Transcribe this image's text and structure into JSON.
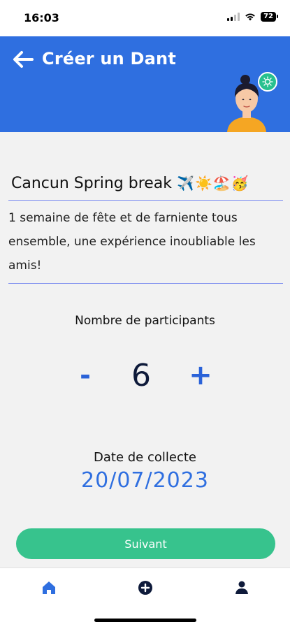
{
  "status_bar": {
    "time": "16:03",
    "battery": "72"
  },
  "header": {
    "title": "Créer un Dant"
  },
  "trip": {
    "title": "Cancun Spring break",
    "title_emojis": "✈️☀️🏖️🥳",
    "description": "1 semaine de fête et de farniente tous ensemble, une expérience inoubliable les amis!"
  },
  "participants": {
    "label": "Nombre de participants",
    "minus": "-",
    "count": "6",
    "plus": "+"
  },
  "collection_date": {
    "label": "Date de collecte",
    "value": "20/07/2023"
  },
  "next_button": {
    "label": "Suivant"
  },
  "tabbar": {
    "items": [
      "home-icon",
      "add-circle-icon",
      "profile-icon"
    ]
  },
  "colors": {
    "primary": "#2f6fe0",
    "accent": "#37c38d"
  }
}
